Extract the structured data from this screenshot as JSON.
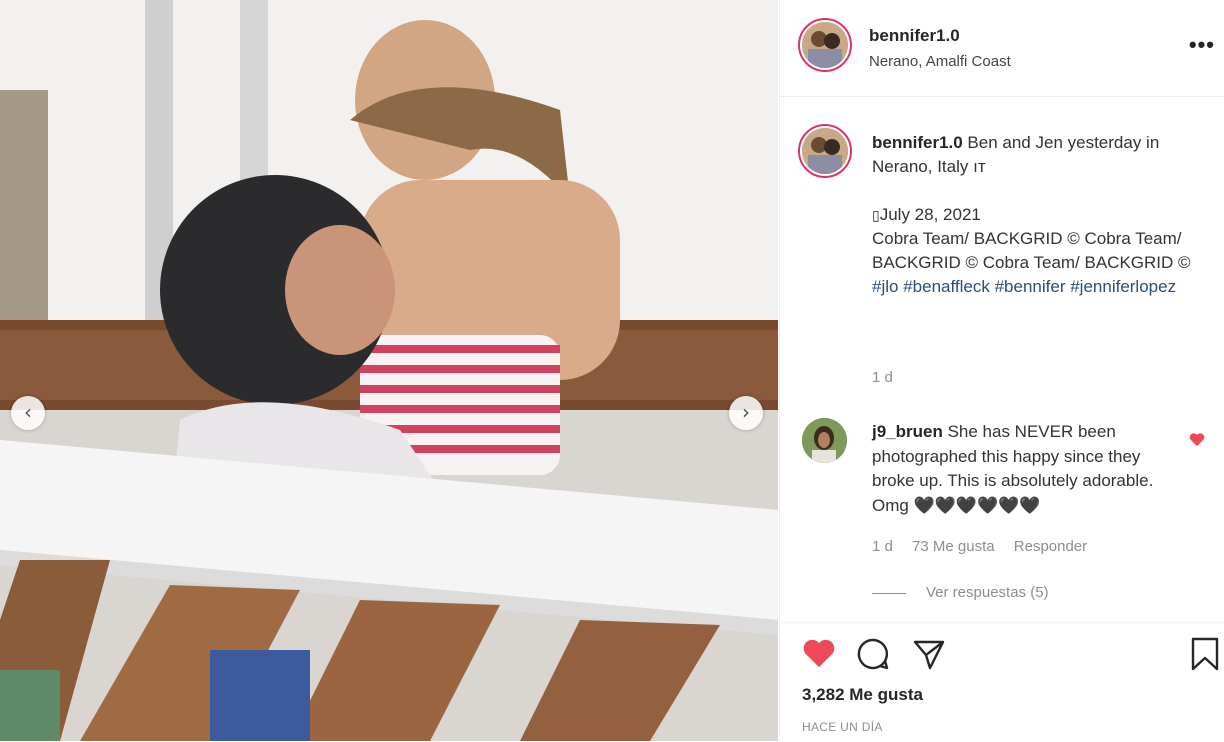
{
  "post": {
    "username": "bennifer1.0",
    "location": "Nerano, Amalfi Coast"
  },
  "caption": {
    "username": "bennifer1.0",
    "text": " Ben and Jen yesterday in Nerano, Italy ıт",
    "date_line": "July 28, 2021",
    "credit": "Cobra Team/ BACKGRID © Cobra Team/ BACKGRID © Cobra Team/ BACKGRID ©",
    "tag1": "#jlo",
    "tag2": "#benaffleck",
    "tag3": "#bennifer",
    "tag4": "#jenniferlopez",
    "time": "1 d"
  },
  "comment": {
    "username": "j9_bruen",
    "text": " She has NEVER been photographed this happy since they broke up. This is absolutely adorable. Omg 🖤🖤🖤🖤🖤🖤",
    "time": "1 d",
    "likes": "73 Me gusta",
    "reply": "Responder",
    "view_replies": "Ver respuestas (5)"
  },
  "footer": {
    "likes": "3,282 Me gusta",
    "ago": "HACE UN DÍA"
  },
  "icons": {
    "heart_color": "#ed4956",
    "ring_color": "#e1306c",
    "hashtag_color": "#2a4e7e"
  }
}
